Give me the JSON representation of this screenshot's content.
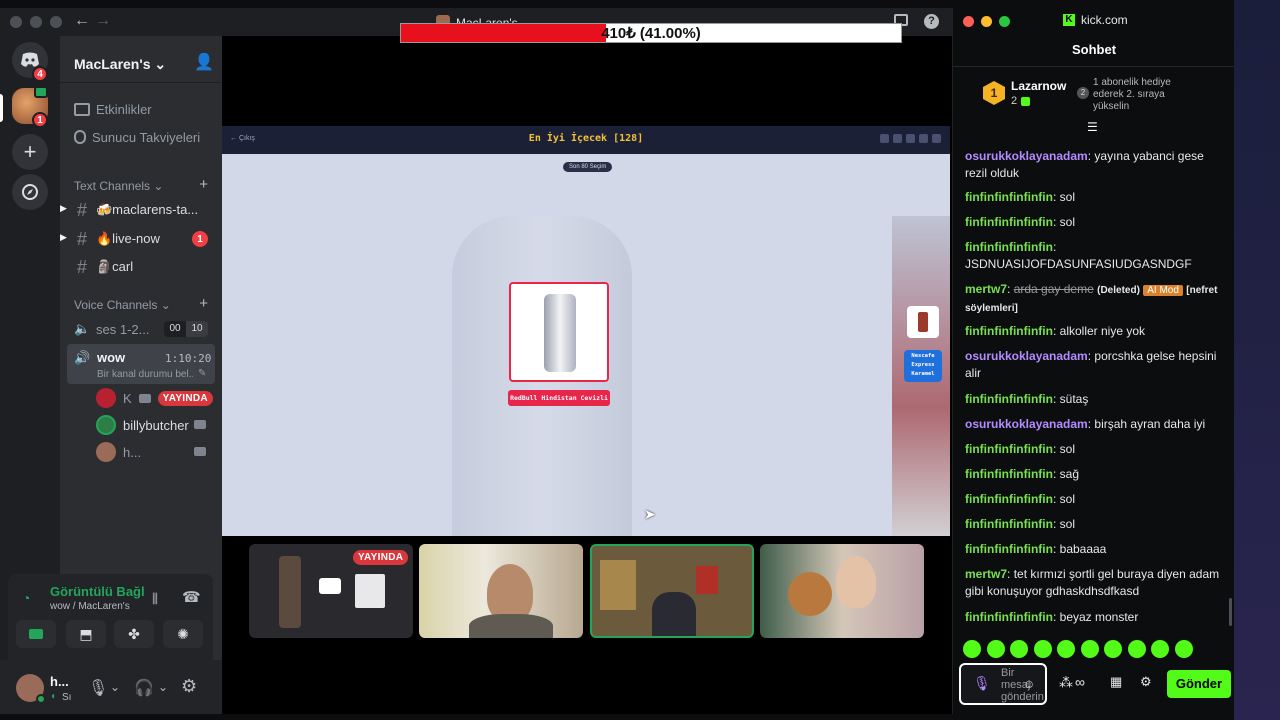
{
  "progress": {
    "text": "410₺ (41.00%)",
    "fraction": 0.41,
    "title_fragment": "MacLaren's"
  },
  "discord": {
    "guild_badges": {
      "home": "4",
      "server": "1"
    },
    "server_name": "MacLaren's",
    "menu": [
      "Etkinlikler",
      "Sunucu Takviyeleri"
    ],
    "text_section": "Text Channels",
    "text_channels": [
      {
        "name": "🍻maclarens-ta...",
        "badge": ""
      },
      {
        "name": "🔥live-now",
        "badge": "1"
      },
      {
        "name": "🗿carl",
        "badge": ""
      }
    ],
    "voice_section": "Voice Channels",
    "voice_channels": [
      {
        "name": "ses 1-2...",
        "count_a": "00",
        "count_b": "10"
      },
      {
        "name": "wow",
        "timer": "1:10:20",
        "status": "Bir kanal durumu bel..."
      }
    ],
    "voice_users": [
      {
        "name": "K",
        "badge": "YAYINDA"
      },
      {
        "name": "billybutcher",
        "badge": ""
      },
      {
        "name": "h...",
        "badge": ""
      }
    ],
    "voice_panel": {
      "title": "Görüntülü Bağl",
      "subtitle": "wow / MacLaren's"
    },
    "user_panel": {
      "name": "h...",
      "status": "Sı"
    },
    "stream": {
      "page_title": "En İyi İçecek [128]",
      "back_label": "← Çıkış",
      "pill": "Son 80 Seçim",
      "card_label": "RedBull Hindistan Cevizli",
      "side_label": "Nescafe Express Karamel",
      "thumb_badge": "YAYINDA"
    }
  },
  "kick": {
    "site": "kick.com",
    "header": "Sohbet",
    "leader": {
      "name": "Lazarnow",
      "rank": "1",
      "count": "2",
      "gift_num": "2",
      "gift_text": "1 abonelik hediye ederek 2. sıraya yükselin"
    },
    "messages": [
      {
        "user": "osurukkoklayanadam",
        "text": "yayına yabanci gese rezil olduk",
        "color": "#b58cff"
      },
      {
        "user": "finfinfinfinfinfin",
        "text": "sol",
        "color": "#77e14e"
      },
      {
        "user": "finfinfinfinfinfin",
        "text": "sol",
        "color": "#77e14e"
      },
      {
        "user": "finfinfinfinfinfin",
        "text": "JSDNUASIJOFDASUNFASIUDGASNDGF",
        "color": "#77e14e"
      },
      {
        "user": "mertw7",
        "text": "arda gay deme",
        "deleted": "(Deleted)",
        "mod": "AI Mod",
        "reason": "[nefret söylemleri]",
        "color": "#77e14e"
      },
      {
        "user": "finfinfinfinfinfin",
        "text": "alkoller niye yok",
        "color": "#77e14e"
      },
      {
        "user": "osurukkoklayanadam",
        "text": "porcshka gelse hepsini alir",
        "color": "#b58cff"
      },
      {
        "user": "finfinfinfinfinfin",
        "text": "sütaş",
        "color": "#77e14e"
      },
      {
        "user": "osurukkoklayanadam",
        "text": "birşah ayran daha iyi",
        "color": "#b58cff"
      },
      {
        "user": "finfinfinfinfinfin",
        "text": "sol",
        "color": "#77e14e"
      },
      {
        "user": "finfinfinfinfinfin",
        "text": "sağ",
        "color": "#77e14e"
      },
      {
        "user": "finfinfinfinfinfin",
        "text": "sol",
        "color": "#77e14e"
      },
      {
        "user": "finfinfinfinfinfin",
        "text": "sol",
        "color": "#77e14e"
      },
      {
        "user": "finfinfinfinfinfin",
        "text": "babaaaa",
        "color": "#77e14e"
      },
      {
        "user": "mertw7",
        "text": "tet kırmızi şortli gel buraya diyen adam gibi konuşuyor gdhaskdhsdfkasd",
        "color": "#77e14e"
      },
      {
        "user": "finfinfinfinfinfin",
        "text": "beyaz monster",
        "color": "#77e14e"
      }
    ],
    "input_placeholder": "Bir mesaj gönderin",
    "send_label": "Gönder",
    "accent": "#53fc18"
  }
}
